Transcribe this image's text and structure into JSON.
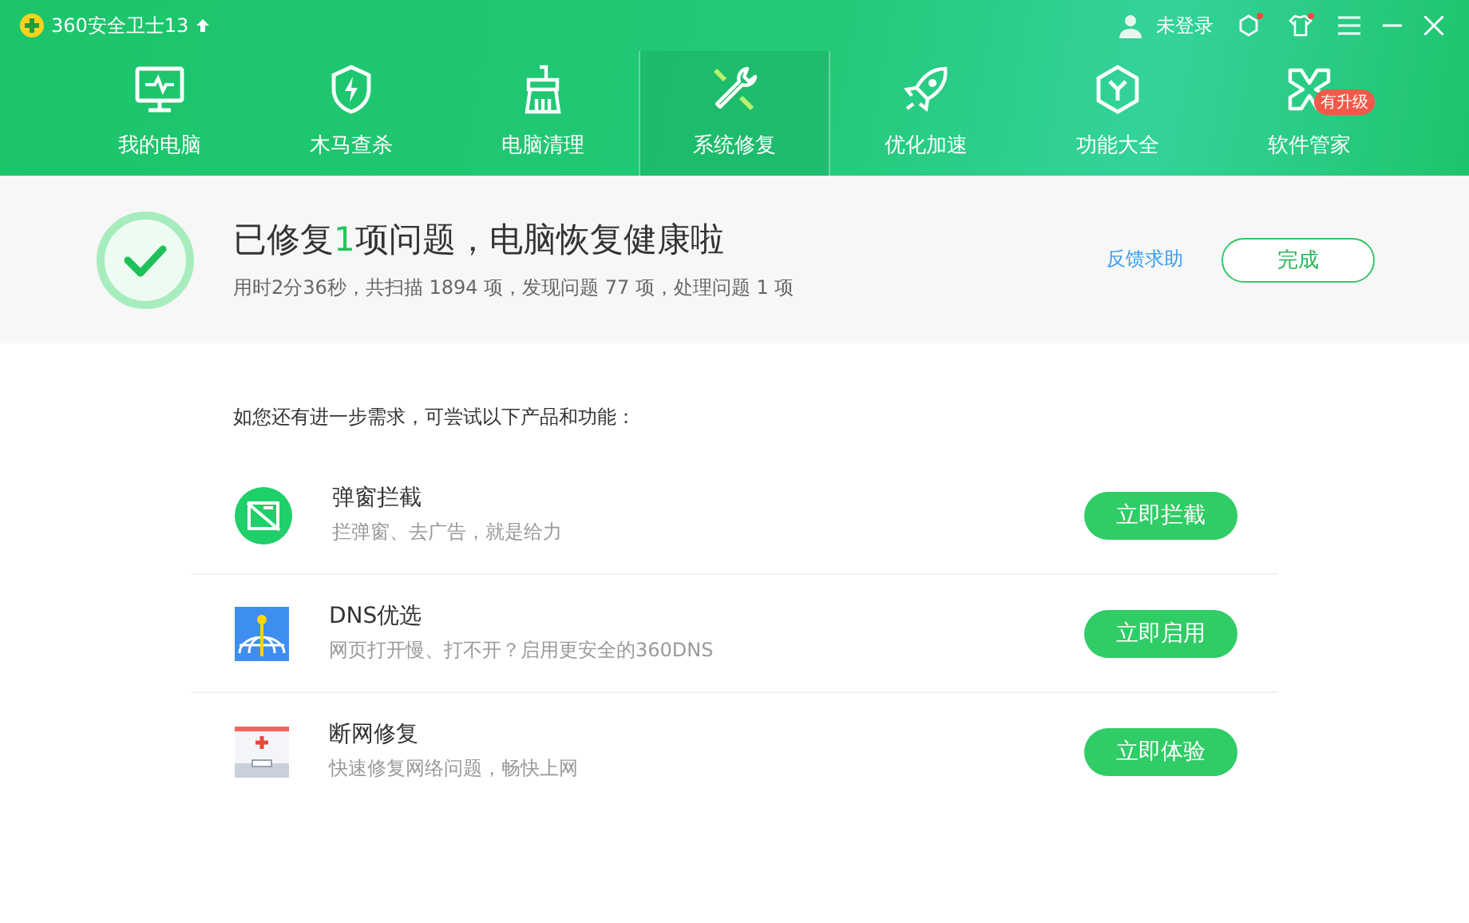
{
  "window": {
    "title": "360安全卫士13",
    "user": "未登录"
  },
  "tabs": [
    {
      "label": "我的电脑",
      "selected": false
    },
    {
      "label": "木马查杀",
      "selected": false
    },
    {
      "label": "电脑清理",
      "selected": false
    },
    {
      "label": "系统修复",
      "selected": true
    },
    {
      "label": "优化加速",
      "selected": false
    },
    {
      "label": "功能大全",
      "selected": false
    },
    {
      "label": "软件管家",
      "selected": false,
      "badge": "有升级"
    }
  ],
  "result": {
    "title": "已修复**1**项问题，电脑恢复健康啦",
    "summary": "用时2分36秒，共扫描 1894 项，发现问题 77 项，处理问题 1 项",
    "feedback": "反馈求助",
    "done": "完成"
  },
  "suggest_heading": "如您还有进一步需求，可尝试以下产品和功能：",
  "products": [
    {
      "kind": "popup",
      "name": "弹窗拦截",
      "desc": "拦弹窗、去广告，就是给力",
      "action": "立即拦截"
    },
    {
      "kind": "dns",
      "name": "DNS优选",
      "desc": "网页打开慢、打不开？启用更安全的360DNS",
      "action": "立即启用"
    },
    {
      "kind": "repair",
      "name": "断网修复",
      "desc": "快速修复网络问题，畅快上网",
      "action": "立即体验"
    }
  ]
}
